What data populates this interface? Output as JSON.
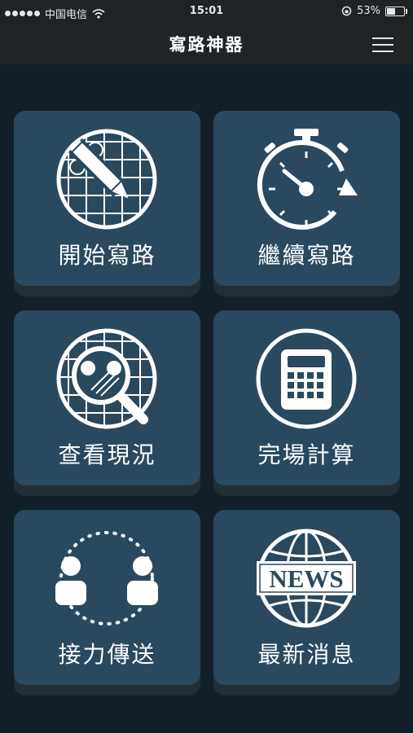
{
  "status_bar": {
    "carrier": "中国电信",
    "time": "15:01",
    "battery": "53%",
    "battery_level": 0.53
  },
  "nav": {
    "title": "寫路神器"
  },
  "tiles": [
    {
      "label": "開始寫路",
      "icon": "grid-pencil-icon"
    },
    {
      "label": "繼續寫路",
      "icon": "stopwatch-icon"
    },
    {
      "label": "查看現況",
      "icon": "magnifier-grid-icon"
    },
    {
      "label": "完場計算",
      "icon": "calculator-icon"
    },
    {
      "label": "接力傳送",
      "icon": "relay-users-icon"
    },
    {
      "label": "最新消息",
      "icon": "globe-news-icon"
    }
  ],
  "news_badge": "NEWS",
  "colors": {
    "background": "#142029",
    "tile": "#2a495f",
    "bar": "#202427"
  }
}
